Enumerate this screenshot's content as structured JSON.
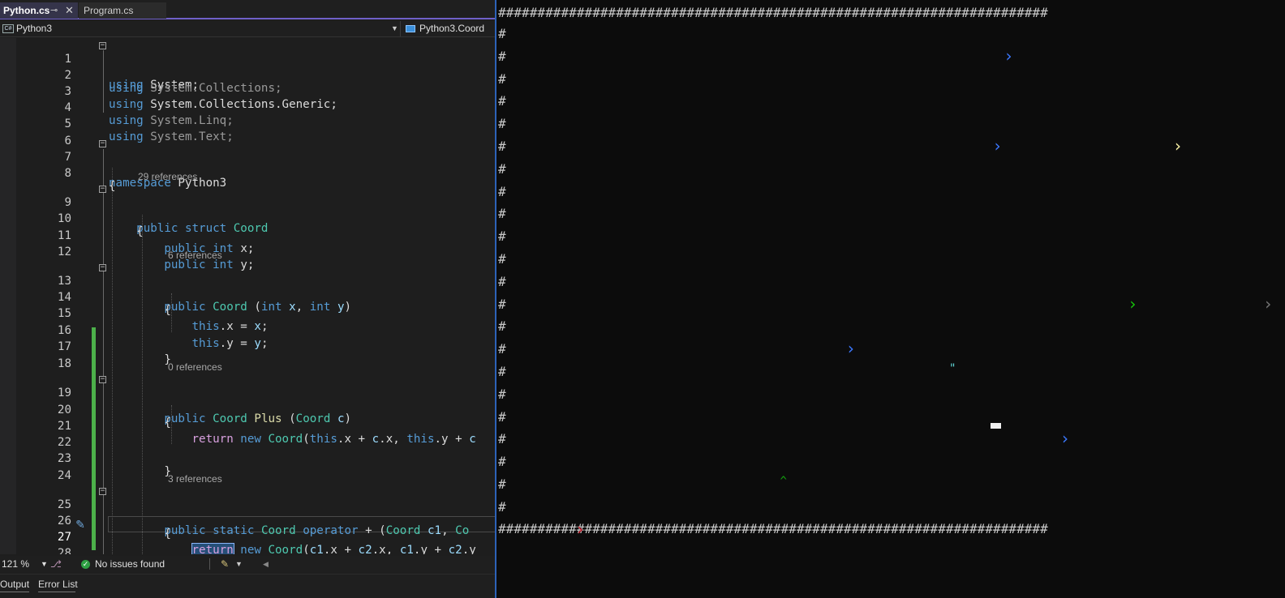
{
  "ide": {
    "tabs": [
      {
        "label": "Python.cs",
        "active": true,
        "pin": "⊸",
        "close": "✕"
      },
      {
        "label": "Program.cs",
        "active": false
      }
    ],
    "nav": {
      "project_icon": "C#",
      "project": "Python3",
      "member": "Python3.Coord"
    },
    "lens": {
      "coord_refs": "29 references",
      "ctor_refs": "6 references",
      "plus_refs": "0 references",
      "op_refs": "3 references"
    },
    "lines": [
      {
        "n": "1"
      },
      {
        "n": "2"
      },
      {
        "n": "3"
      },
      {
        "n": "4"
      },
      {
        "n": "5"
      },
      {
        "n": "6"
      },
      {
        "n": "7"
      },
      {
        "n": "8"
      },
      {
        "n": "9"
      },
      {
        "n": "10"
      },
      {
        "n": "11"
      },
      {
        "n": "12"
      },
      {
        "n": "13"
      },
      {
        "n": "14"
      },
      {
        "n": "15"
      },
      {
        "n": "16"
      },
      {
        "n": "17"
      },
      {
        "n": "18"
      },
      {
        "n": "19"
      },
      {
        "n": "20"
      },
      {
        "n": "21"
      },
      {
        "n": "22"
      },
      {
        "n": "23"
      },
      {
        "n": "24"
      },
      {
        "n": "25"
      },
      {
        "n": "26"
      },
      {
        "n": "27"
      },
      {
        "n": "28"
      }
    ],
    "code": {
      "using": "using",
      "system": "System",
      "collections": "System.Collections",
      "generic": "System.Collections.Generic",
      "linq": "System.Linq",
      "text": "System.Text",
      "namespace_kw": "namespace",
      "namespace_name": "Python3",
      "public": "public",
      "struct": "struct",
      "static": "static",
      "operator": "operator",
      "int": "int",
      "this": "this",
      "return": "return",
      "new": "new",
      "coord": "Coord",
      "plus": "Plus"
    },
    "status": {
      "zoom": "121 %",
      "issues": "No issues found"
    },
    "bottom_tabs": [
      "Output",
      "Error List"
    ]
  },
  "console": {
    "wall_char": "#",
    "sprites": [
      {
        "glyph": "›",
        "color": "#3b78ff",
        "row": 1,
        "col": 45
      },
      {
        "glyph": "›",
        "color": "#3b78ff",
        "row": 5,
        "col": 44
      },
      {
        "glyph": "›",
        "color": "#f9f1a5",
        "row": 5,
        "col": 60
      },
      {
        "glyph": "›",
        "color": "#16c60c",
        "row": 10,
        "col": 70
      },
      {
        "glyph": "›",
        "color": "#16c60c",
        "row": 12,
        "col": 56
      },
      {
        "glyph": "›",
        "color": "#767676",
        "row": 12,
        "col": 68
      },
      {
        "glyph": "›",
        "color": "#3b78ff",
        "row": 14,
        "col": 31
      },
      {
        "glyph": "›",
        "color": "#3b78ff",
        "row": 18,
        "col": 50
      },
      {
        "glyph": "›",
        "color": "#c50f1f",
        "row": 22,
        "col": 7
      }
    ],
    "items": [
      {
        "glyph": "\"",
        "color": "#61d6d6",
        "row": 15,
        "col": 40
      },
      {
        "glyph": "^",
        "color": "#13a10e",
        "row": 20,
        "col": 25
      }
    ],
    "colors": {
      "wall": "#c8c8c8",
      "background": "#0c0c0c"
    }
  }
}
